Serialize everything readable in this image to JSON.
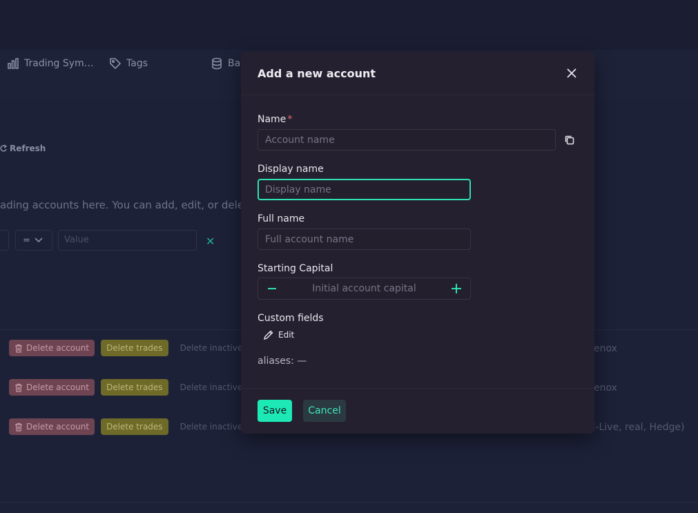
{
  "nav": {
    "items": [
      {
        "label": "Trading Sym…",
        "icon": "bar-chart-icon"
      },
      {
        "label": "Tags",
        "icon": "tag-icon"
      },
      {
        "label": "Ba",
        "icon": "database-icon"
      }
    ]
  },
  "background": {
    "refresh_label": "Refresh",
    "description": "ading accounts here. You can add, edit, or delete a",
    "filter": {
      "operator": "=",
      "value_placeholder": "Value"
    },
    "rows": [
      {
        "delete_account": "Delete account",
        "delete_trades": "Delete trades",
        "inactive": "Delete inactive tra",
        "tail": "enox"
      },
      {
        "delete_account": "Delete account",
        "delete_trades": "Delete trades",
        "inactive": "Delete inactive tra",
        "tail": "enox"
      },
      {
        "delete_account": "Delete account",
        "delete_trades": "Delete trades",
        "inactive": "Delete inactive tra",
        "tail": "al-Live, real, Hedge)"
      }
    ]
  },
  "modal": {
    "title": "Add a new account",
    "name": {
      "label": "Name",
      "required_mark": "*",
      "placeholder": "Account name"
    },
    "display_name": {
      "label": "Display name",
      "placeholder": "Display name"
    },
    "full_name": {
      "label": "Full name",
      "placeholder": "Full account name"
    },
    "starting_capital": {
      "label": "Starting Capital",
      "placeholder": "Initial account capital"
    },
    "custom_fields": {
      "label": "Custom fields",
      "edit_label": "Edit"
    },
    "aliases": "aliases: —",
    "save_label": "Save",
    "cancel_label": "Cancel"
  },
  "colors": {
    "accent": "#1de9b6",
    "background": "#1b1d33",
    "modal": "#25202f",
    "danger_button": "#6e4453",
    "warning_button": "#6e6a28"
  }
}
